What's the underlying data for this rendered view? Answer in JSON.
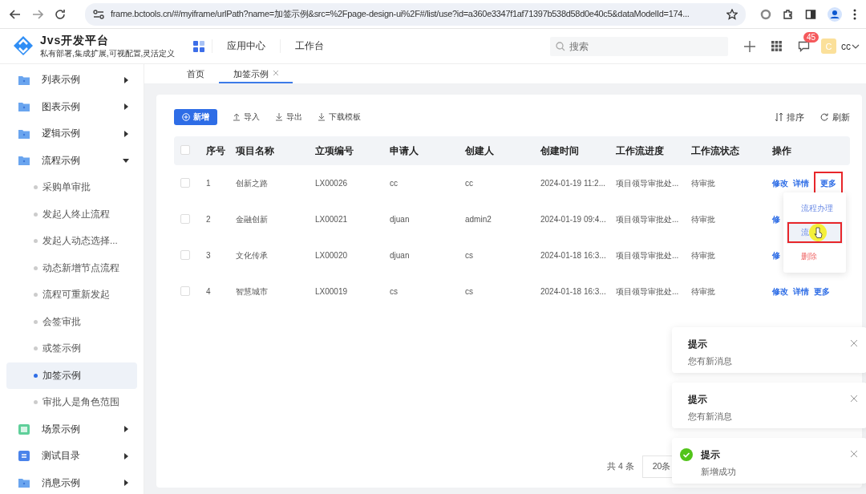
{
  "browser": {
    "url": "frame.bctools.cn/#/myiframe/urlPath?name=加签示例&src=%2Fpage-design-ui%2F#/list/use?id=a360e3347f1af71397b538d58d0e40c5&dataModelId=174..."
  },
  "header": {
    "logo_title": "Jvs开发平台",
    "logo_subtitle": "私有部署,集成扩展,可视配置,灵活定义",
    "nav": [
      "应用中心",
      "工作台"
    ],
    "search": {
      "placeholder": "搜索"
    },
    "badge": "45",
    "avatar": "C",
    "user": "cc"
  },
  "sidebar": {
    "items": [
      {
        "label": "列表示例",
        "kind": "folder",
        "expanded": false
      },
      {
        "label": "图表示例",
        "kind": "folder",
        "expanded": false
      },
      {
        "label": "逻辑示例",
        "kind": "folder",
        "expanded": false
      },
      {
        "label": "流程示例",
        "kind": "folder",
        "expanded": true,
        "children": [
          {
            "label": "采购单审批",
            "selected": false
          },
          {
            "label": "发起人终止流程",
            "selected": false
          },
          {
            "label": "发起人动态选择...",
            "selected": false
          },
          {
            "label": "动态新增节点流程",
            "selected": false
          },
          {
            "label": "流程可重新发起",
            "selected": false
          },
          {
            "label": "会签审批",
            "selected": false
          },
          {
            "label": "或签示例",
            "selected": false
          },
          {
            "label": "加签示例",
            "selected": true
          },
          {
            "label": "审批人是角色范围",
            "selected": false
          }
        ]
      },
      {
        "label": "场景示例",
        "kind": "scene",
        "expanded": false
      },
      {
        "label": "测试目录",
        "kind": "doc",
        "expanded": false
      },
      {
        "label": "消息示例",
        "kind": "folder",
        "expanded": false
      }
    ]
  },
  "tabs": [
    {
      "label": "首页",
      "selected": false,
      "closable": false
    },
    {
      "label": "加签示例",
      "selected": true,
      "closable": true
    }
  ],
  "toolbar": {
    "add": "新增",
    "actions": [
      "导入",
      "导出",
      "下载模板"
    ],
    "sort": "排序",
    "refresh": "刷新"
  },
  "table": {
    "select_all_checked": false,
    "columns": [
      "序号",
      "项目名称",
      "立项编号",
      "申请人",
      "创建人",
      "创建时间",
      "工作流进度",
      "工作流状态",
      "操作"
    ],
    "rows": [
      {
        "checked": false,
        "cells": [
          "1",
          "创新之路",
          "LX00026",
          "cc",
          "cc",
          "2024-01-19 11:2...",
          "项目领导审批处...",
          "待审批"
        ],
        "actions": [
          {
            "label": "修改",
            "highlighted": false
          },
          {
            "label": "详情",
            "highlighted": false
          },
          {
            "label": "更多",
            "highlighted": true
          }
        ]
      },
      {
        "checked": false,
        "cells": [
          "2",
          "金融创新",
          "LX00021",
          "djuan",
          "admin2",
          "2024-01-19 09:4...",
          "项目领导审批处...",
          "待审批"
        ],
        "actions": [
          {
            "label": "修",
            "highlighted": false
          }
        ]
      },
      {
        "checked": false,
        "cells": [
          "3",
          "文化传承",
          "LX00020",
          "djuan",
          "cs",
          "2024-01-18 16:3...",
          "项目领导审批处...",
          "待审批"
        ],
        "actions": [
          {
            "label": "修",
            "highlighted": false
          }
        ]
      },
      {
        "checked": false,
        "cells": [
          "4",
          "智慧城市",
          "LX00019",
          "cs",
          "cs",
          "2024-01-18 16:3...",
          "项目领导审批处...",
          "待审批"
        ],
        "actions": [
          {
            "label": "修改",
            "highlighted": false
          },
          {
            "label": "详情",
            "highlighted": false
          },
          {
            "label": "更多",
            "highlighted": false
          }
        ]
      }
    ]
  },
  "dropdown": [
    {
      "label": "流程办理",
      "kind": "normal",
      "highlighted": false
    },
    {
      "label": "流",
      "kind": "normal",
      "highlighted": true
    },
    {
      "label": "删除",
      "kind": "danger",
      "highlighted": false
    }
  ],
  "pagination": {
    "total": "共 4 条",
    "page_size": "20条"
  },
  "notifications": [
    {
      "title": "提示",
      "message": "您有新消息",
      "kind": "info"
    },
    {
      "title": "提示",
      "message": "您有新消息",
      "kind": "info"
    },
    {
      "title": "提示",
      "message": "新增成功",
      "kind": "success"
    }
  ]
}
